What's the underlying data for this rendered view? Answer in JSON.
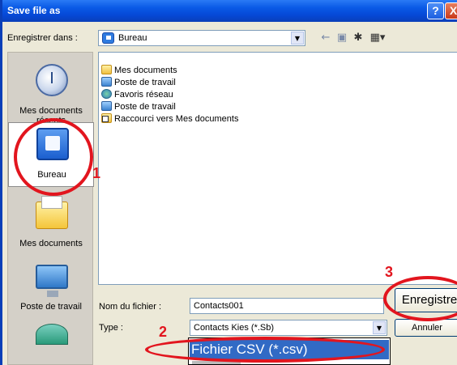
{
  "window": {
    "title": "Save file as",
    "help_label": "?",
    "close_label": "X"
  },
  "savein": {
    "label": "Enregistrer dans :",
    "value": "Bureau"
  },
  "toolbar": {
    "back_glyph": "←",
    "up_glyph": "▣",
    "newfolder_glyph": "✱",
    "views_glyph": "▦▾"
  },
  "places": [
    {
      "label": "Mes documents récents",
      "icon": "recent-icon"
    },
    {
      "label": "Bureau",
      "icon": "desktop-icon"
    },
    {
      "label": "Mes documents",
      "icon": "documents-folder-icon"
    },
    {
      "label": "Poste de travail",
      "icon": "computer-icon"
    },
    {
      "label": "",
      "icon": "network-icon"
    }
  ],
  "files": [
    {
      "name": "Mes documents",
      "icon": "folder-icon"
    },
    {
      "name": "Poste de travail",
      "icon": "computer-icon"
    },
    {
      "name": "Favoris réseau",
      "icon": "network-icon"
    },
    {
      "name": "Poste de travail",
      "icon": "shortcut-icon"
    },
    {
      "name": "Raccourci vers Mes documents",
      "icon": "shortcut-folder-icon"
    }
  ],
  "form": {
    "filename_label": "Nom du fichier :",
    "filename_value": "Contacts001",
    "type_label": "Type :",
    "type_value": "Contacts Kies (*.Sb)",
    "save_label": "Enregistre",
    "cancel_label": "Annuler"
  },
  "dropdown": {
    "selected_option": "Fichier CSV (*.csv)"
  },
  "annotations": {
    "step1": "1",
    "step2": "2",
    "step3": "3",
    "color": "#e2151e"
  }
}
